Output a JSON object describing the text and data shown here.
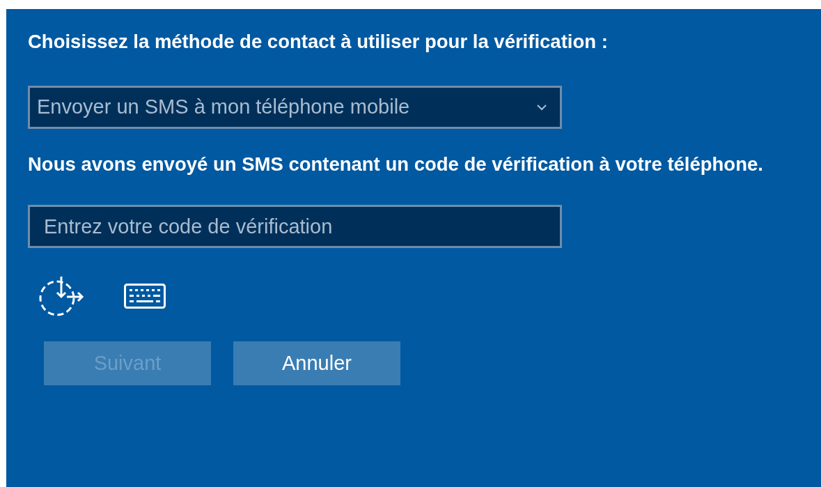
{
  "prompt": "Choisissez la méthode de contact à utiliser pour la vérification :",
  "method_select": {
    "value": "Envoyer un SMS à mon téléphone mobile"
  },
  "message": "Nous avons envoyé un SMS contenant un code de vérification à votre téléphone.",
  "code_field": {
    "placeholder": "Entrez votre code de vérification"
  },
  "buttons": [
    {
      "label": "Suivant",
      "disabled": true
    },
    {
      "label": "Annuler",
      "disabled": false
    }
  ]
}
